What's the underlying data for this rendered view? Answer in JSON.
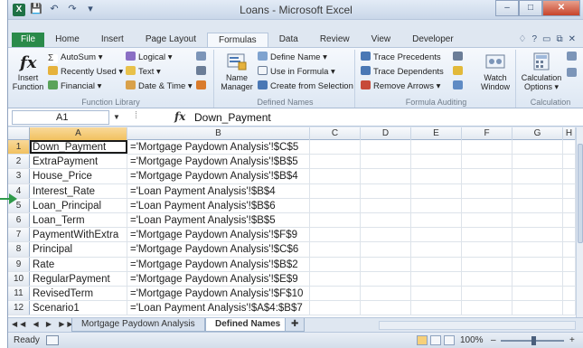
{
  "window": {
    "title": "Loans - Microsoft Excel",
    "qat": [
      "💾",
      "↶",
      "↷",
      "▾"
    ],
    "controls": {
      "minimize": "–",
      "maximize": "□",
      "close": "✕"
    }
  },
  "ribbon": {
    "tabs": [
      "File",
      "Home",
      "Insert",
      "Page Layout",
      "Formulas",
      "Data",
      "Review",
      "View",
      "Developer"
    ],
    "active_tab": "Formulas",
    "right_icons": [
      "♢",
      "?",
      "▭",
      "⧉",
      "✕"
    ],
    "function_library": {
      "label": "Function Library",
      "insert_function": "Insert Function",
      "autosum": "AutoSum ▾",
      "recently_used": "Recently Used ▾",
      "financial": "Financial ▾",
      "logical": "Logical ▾",
      "text": "Text ▾",
      "date_time": "Date & Time ▾"
    },
    "defined_names": {
      "label": "Defined Names",
      "name_manager": "Name Manager",
      "define_name": "Define Name ▾",
      "use_in_formula": "Use in Formula ▾",
      "create_from_selection": "Create from Selection"
    },
    "formula_auditing": {
      "label": "Formula Auditing",
      "trace_precedents": "Trace Precedents",
      "trace_dependents": "Trace Dependents",
      "remove_arrows": "Remove Arrows ▾",
      "watch_window": "Watch Window"
    },
    "calculation": {
      "label": "Calculation",
      "calculation_options": "Calculation Options ▾"
    }
  },
  "formula_bar": {
    "name_box": "A1",
    "fx": "fx",
    "content": "Down_Payment"
  },
  "grid": {
    "columns": [
      "A",
      "B",
      "C",
      "D",
      "E",
      "F",
      "G",
      "H"
    ],
    "selected_column": "A",
    "rows": [
      {
        "num": "1",
        "a": "Down_Payment",
        "b": "='Mortgage Paydown Analysis'!$C$5"
      },
      {
        "num": "2",
        "a": "ExtraPayment",
        "b": "='Mortgage Paydown Analysis'!$B$5"
      },
      {
        "num": "3",
        "a": "House_Price",
        "b": "='Mortgage Paydown Analysis'!$B$4"
      },
      {
        "num": "4",
        "a": "Interest_Rate",
        "b": "='Loan Payment Analysis'!$B$4"
      },
      {
        "num": "5",
        "a": "Loan_Principal",
        "b": "='Loan Payment Analysis'!$B$6"
      },
      {
        "num": "6",
        "a": "Loan_Term",
        "b": "='Loan Payment Analysis'!$B$5"
      },
      {
        "num": "7",
        "a": "PaymentWithExtra",
        "b": "='Mortgage Paydown Analysis'!$F$9"
      },
      {
        "num": "8",
        "a": "Principal",
        "b": "='Mortgage Paydown Analysis'!$C$6"
      },
      {
        "num": "9",
        "a": "Rate",
        "b": "='Mortgage Paydown Analysis'!$B$2"
      },
      {
        "num": "10",
        "a": "RegularPayment",
        "b": "='Mortgage Paydown Analysis'!$E$9"
      },
      {
        "num": "11",
        "a": "RevisedTerm",
        "b": "='Mortgage Paydown Analysis'!$F$10"
      },
      {
        "num": "12",
        "a": "Scenario1",
        "b": "='Loan Payment Analysis'!$A$4:$B$7"
      }
    ]
  },
  "sheets": {
    "tabs": [
      "Mortgage Paydown Analysis",
      "Defined Names"
    ],
    "active": "Defined Names"
  },
  "status": {
    "text": "Ready",
    "zoom": "100%",
    "zoom_out": "–",
    "zoom_in": "+"
  },
  "colors": {
    "accent": "#2a8a4a",
    "selection_header": "#f1c15f",
    "ribbon_bg": "#dde7f3"
  }
}
